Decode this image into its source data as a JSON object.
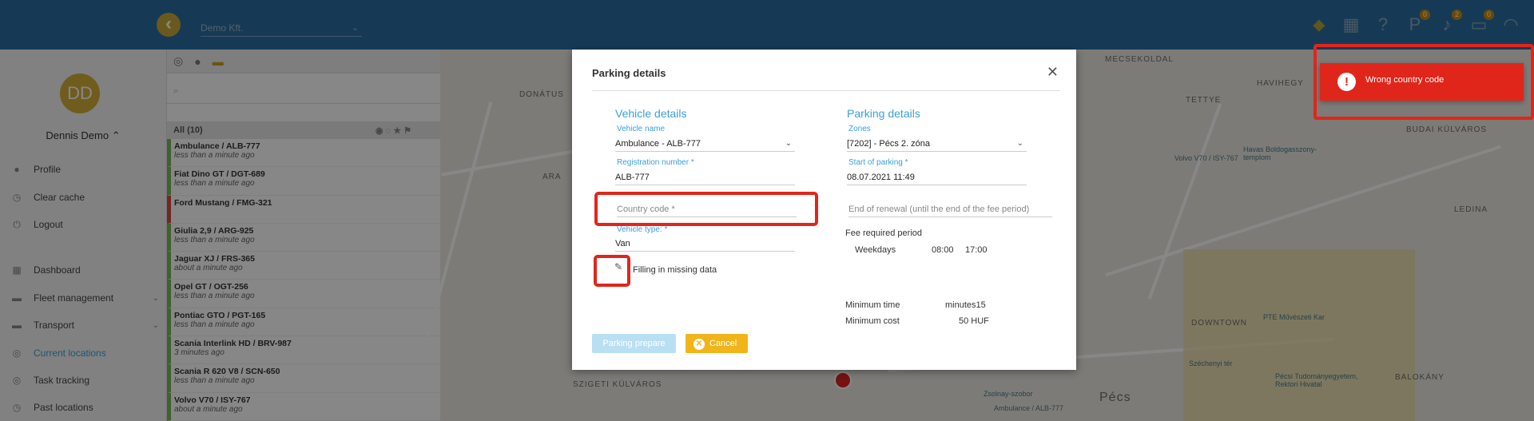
{
  "header": {
    "company": "Demo Kft.",
    "badges": {
      "parking": "0",
      "notifications": "2",
      "messages": "0"
    }
  },
  "sidebar": {
    "initials": "DD",
    "user": "Dennis Demo",
    "items": [
      {
        "label": "Profile",
        "icon": "person-icon"
      },
      {
        "label": "Clear cache",
        "icon": "clock-icon"
      },
      {
        "label": "Logout",
        "icon": "power-icon"
      },
      {
        "label": "Dashboard",
        "icon": "dashboard-icon"
      },
      {
        "label": "Fleet management",
        "icon": "car-icon"
      },
      {
        "label": "Transport",
        "icon": "truck-icon"
      },
      {
        "label": "Current locations",
        "icon": "target-icon"
      },
      {
        "label": "Task tracking",
        "icon": "target-icon"
      },
      {
        "label": "Past locations",
        "icon": "history-icon"
      }
    ]
  },
  "vehicles": {
    "header_label": "All",
    "header_count": "(10)",
    "rows": [
      {
        "name": "Ambulance / ALB-777",
        "time": "less than a minute ago"
      },
      {
        "name": "Fiat Dino GT / DGT-689",
        "time": "less than a minute ago"
      },
      {
        "name": "Ford Mustang / FMG-321",
        "time": ""
      },
      {
        "name": "Giulia 2,9 / ARG-925",
        "time": "less than a minute ago"
      },
      {
        "name": "Jaguar XJ / FRS-365",
        "time": "about a minute ago"
      },
      {
        "name": "Opel GT / OGT-256",
        "time": "less than a minute ago"
      },
      {
        "name": "Pontiac GTO / PGT-165",
        "time": "less than a minute ago"
      },
      {
        "name": "Scania Interlink HD / BRV-987",
        "time": "3 minutes ago"
      },
      {
        "name": "Scania R 620 V8 / SCN-650",
        "time": "less than a minute ago"
      },
      {
        "name": "Volvo V70 / ISY-767",
        "time": "about a minute ago"
      }
    ]
  },
  "map": {
    "labels": [
      "MECSEKOLDAL",
      "HAVIHEGY",
      "TETTYE",
      "BUDAI KÜLVÁROS",
      "DONÁTUS",
      "ARA",
      "LEDINA",
      "DOWNTOWN",
      "BALOKÁNY",
      "SZIGETI KÜLVÁROS",
      "Pécs"
    ],
    "pois": [
      "Havas Boldogasszony-templom",
      "Volvo V70 / ISY-767",
      "PTE Művészeti Kar",
      "Pécsi Tudományegyetem, Rektori Hivatal",
      "Ambulance / ALB-777",
      "Zsolnay-szobor",
      "Széchenyi tér"
    ]
  },
  "dialog": {
    "title": "Parking details",
    "vehicle_section": "Vehicle details",
    "vehicle_name_label": "Vehicle name",
    "vehicle_name": "Ambulance - ALB-777",
    "registration_label": "Registration number *",
    "registration": "ALB-777",
    "country_placeholder": "Country code *",
    "vehicle_type_label": "Vehicle type: *",
    "vehicle_type": "Van",
    "filling_label": "Filling in missing data",
    "parking_section": "Parking details",
    "zones_label": "Zones",
    "zone": "[7202] - Pécs 2. zóna",
    "start_label": "Start of parking *",
    "start": "08.07.2021 11:49",
    "renewal_placeholder": "End of renewal (until the end of the fee period)",
    "fee_period_label": "Fee required period",
    "fee_day": "Weekdays",
    "fee_from": "08:00",
    "fee_to": "17:00",
    "min_time_label": "Minimum time",
    "min_time_value": "minutes15",
    "min_cost_label": "Minimum cost",
    "min_cost_value": "50 HUF",
    "prepare_btn": "Parking prepare",
    "cancel_btn": "Cancel"
  },
  "toast": {
    "message": "Wrong country code"
  }
}
